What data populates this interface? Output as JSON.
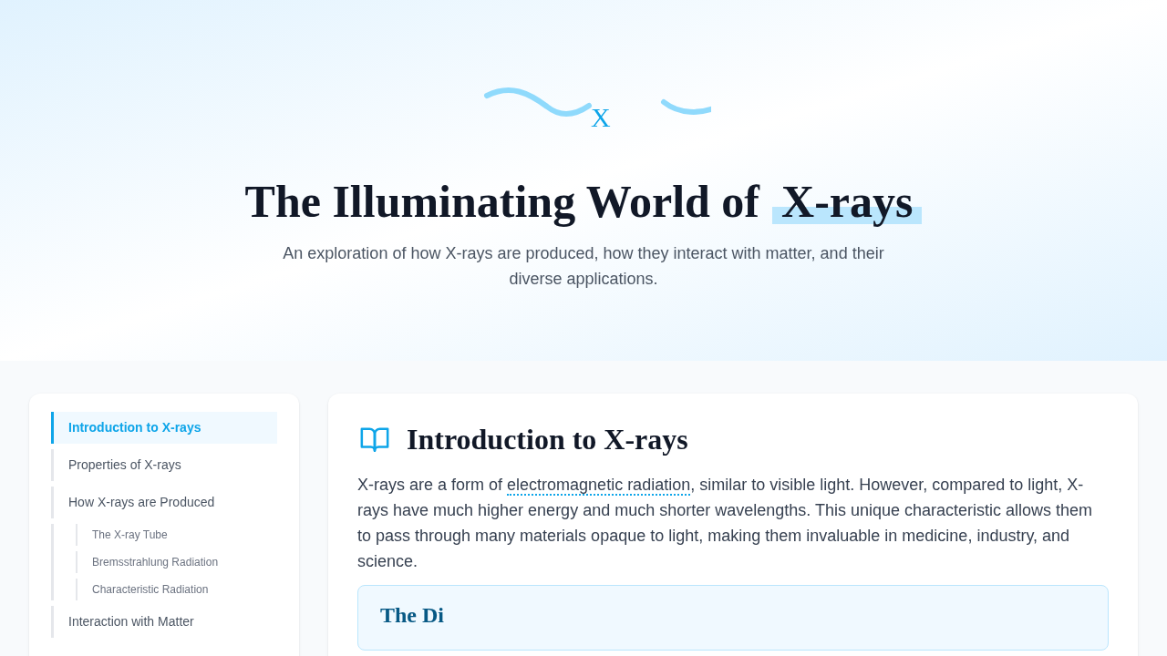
{
  "hero": {
    "logo_letter": "X",
    "title": "The Illuminating World of",
    "title_highlight": "X-rays",
    "subtitle": "An exploration of how X-rays are produced, how they interact with matter, and their diverse applications."
  },
  "sidebar": {
    "items": [
      {
        "label": "Introduction to X-rays",
        "selected": true
      },
      {
        "label": "Properties of X-rays",
        "selected": false
      },
      {
        "label": "How X-rays are Produced",
        "selected": false,
        "children": [
          {
            "label": "The X-ray Tube",
            "selected": false
          },
          {
            "label": "Bremsstrahlung Radiation",
            "selected": false
          },
          {
            "label": "Characteristic Radiation",
            "selected": false
          }
        ]
      },
      {
        "label": "Interaction with Matter",
        "selected": false
      }
    ]
  },
  "section": {
    "title": "Introduction to X-rays",
    "text_before": "X-rays are a form of ",
    "link": "electromagnetic radiation",
    "text_after": ", similar to visible light. However, compared to light, X-rays have much higher energy and much shorter wavelengths. This unique characteristic allows them to pass through many materials opaque to light, making them invaluable in medicine, industry, and science.",
    "callout_title": "The Di"
  }
}
